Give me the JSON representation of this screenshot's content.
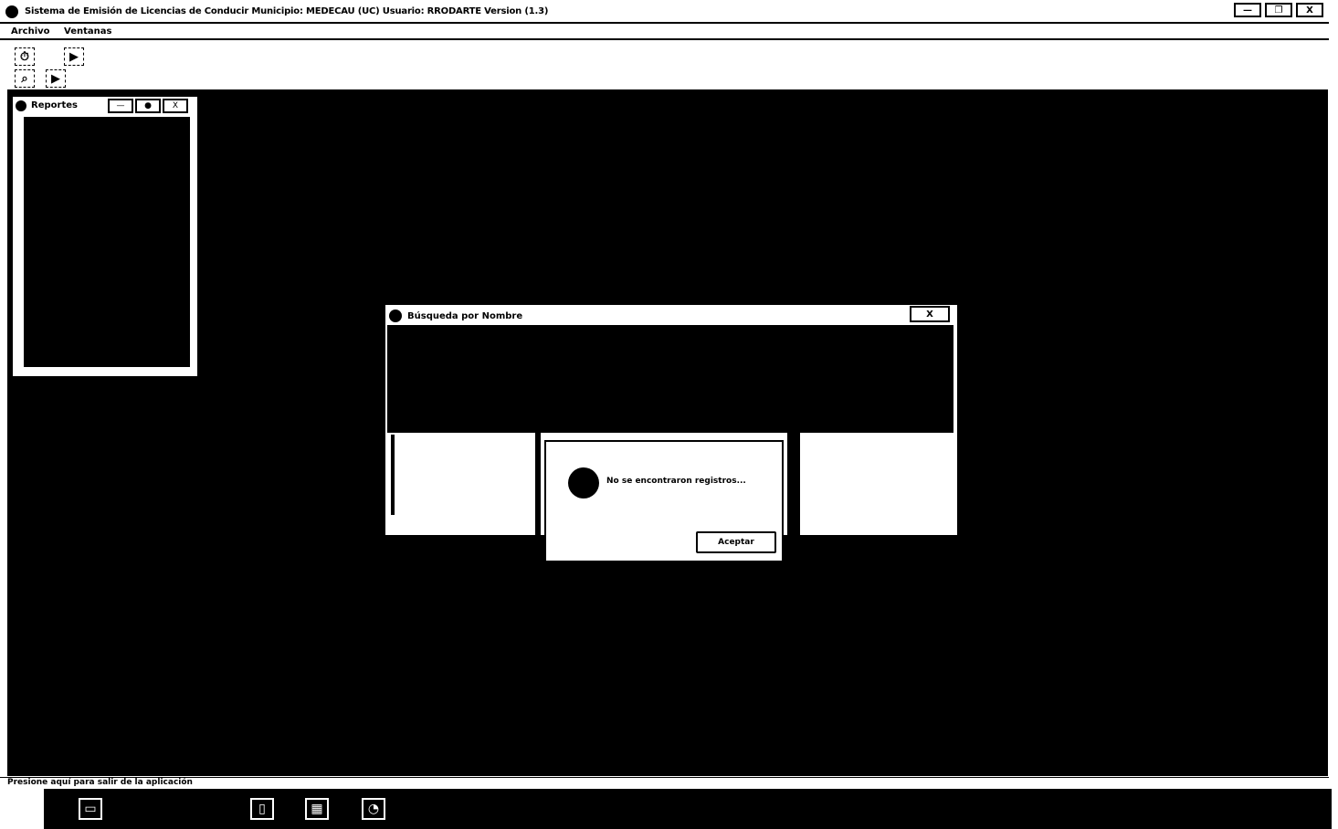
{
  "window": {
    "title": "Sistema de Emisión de Licencias de Conducir   Municipio: MEDECAU (UC)   Usuario: RRODARTE   Version (1.3)",
    "minimize_label": "—",
    "restore_label": "❐",
    "close_label": "X"
  },
  "menu": {
    "items": [
      "Archivo",
      "Ventanas"
    ]
  },
  "toolbar": {
    "buttons": [
      {
        "icon": "clock-icon",
        "glyph": "⏱"
      },
      {
        "icon": "exit-icon",
        "glyph": "▶"
      },
      {
        "icon": "search-icon",
        "glyph": "⌕"
      },
      {
        "icon": "exit-icon",
        "glyph": "▶"
      }
    ]
  },
  "mini_window": {
    "title": "Reportes",
    "buttons": [
      "—",
      "●",
      "X"
    ]
  },
  "search_window": {
    "title": "Búsqueda por Nombre",
    "close_label": "X"
  },
  "alert": {
    "message": "No se encontraron registros...",
    "accept_label": "Aceptar"
  },
  "statusbar": {
    "text": "Presione aquí para salir de la aplicación"
  },
  "taskbar": {
    "icons": [
      "folder-icon",
      "document-icon",
      "spreadsheet-icon",
      "network-icon"
    ]
  }
}
